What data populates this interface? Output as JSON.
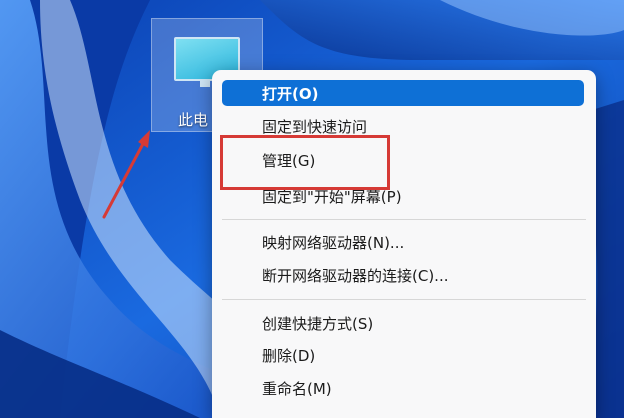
{
  "desktop": {
    "icon_label": "此电"
  },
  "context_menu": {
    "items": [
      {
        "label": "打开(O)"
      },
      {
        "label": "固定到快速访问"
      },
      {
        "label": "管理(G)"
      },
      {
        "label": "固定到\"开始\"屏幕(P)"
      },
      {
        "label": "映射网络驱动器(N)..."
      },
      {
        "label": "断开网络驱动器的连接(C)..."
      },
      {
        "label": "创建快捷方式(S)"
      },
      {
        "label": "删除(D)"
      },
      {
        "label": "重命名(M)"
      }
    ]
  },
  "colors": {
    "selected_accent": "#0e70d6",
    "annotation_red": "#d63a36"
  }
}
